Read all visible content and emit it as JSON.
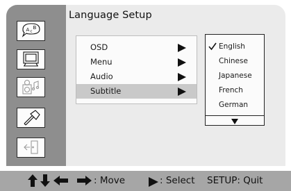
{
  "page": {
    "title": "Language Setup"
  },
  "sidebar": {
    "items": [
      {
        "icon": "language-speech-bubble-icon",
        "selected": true
      },
      {
        "icon": "tv-display-icon"
      },
      {
        "icon": "audio-speaker-music-icon",
        "dimmed": true
      },
      {
        "icon": "hammer-tools-icon"
      },
      {
        "icon": "exit-door-icon"
      }
    ]
  },
  "menu": {
    "items": [
      {
        "label": "OSD"
      },
      {
        "label": "Menu"
      },
      {
        "label": "Audio"
      },
      {
        "label": "Subtitle",
        "selected": true
      }
    ]
  },
  "options": {
    "items": [
      {
        "label": "English",
        "checked": true
      },
      {
        "label": "Chinese"
      },
      {
        "label": "Japanese"
      },
      {
        "label": "French"
      },
      {
        "label": "German"
      }
    ]
  },
  "footer": {
    "move_label": ": Move",
    "select_label": ": Select",
    "quit_label": "SETUP: Quit"
  }
}
